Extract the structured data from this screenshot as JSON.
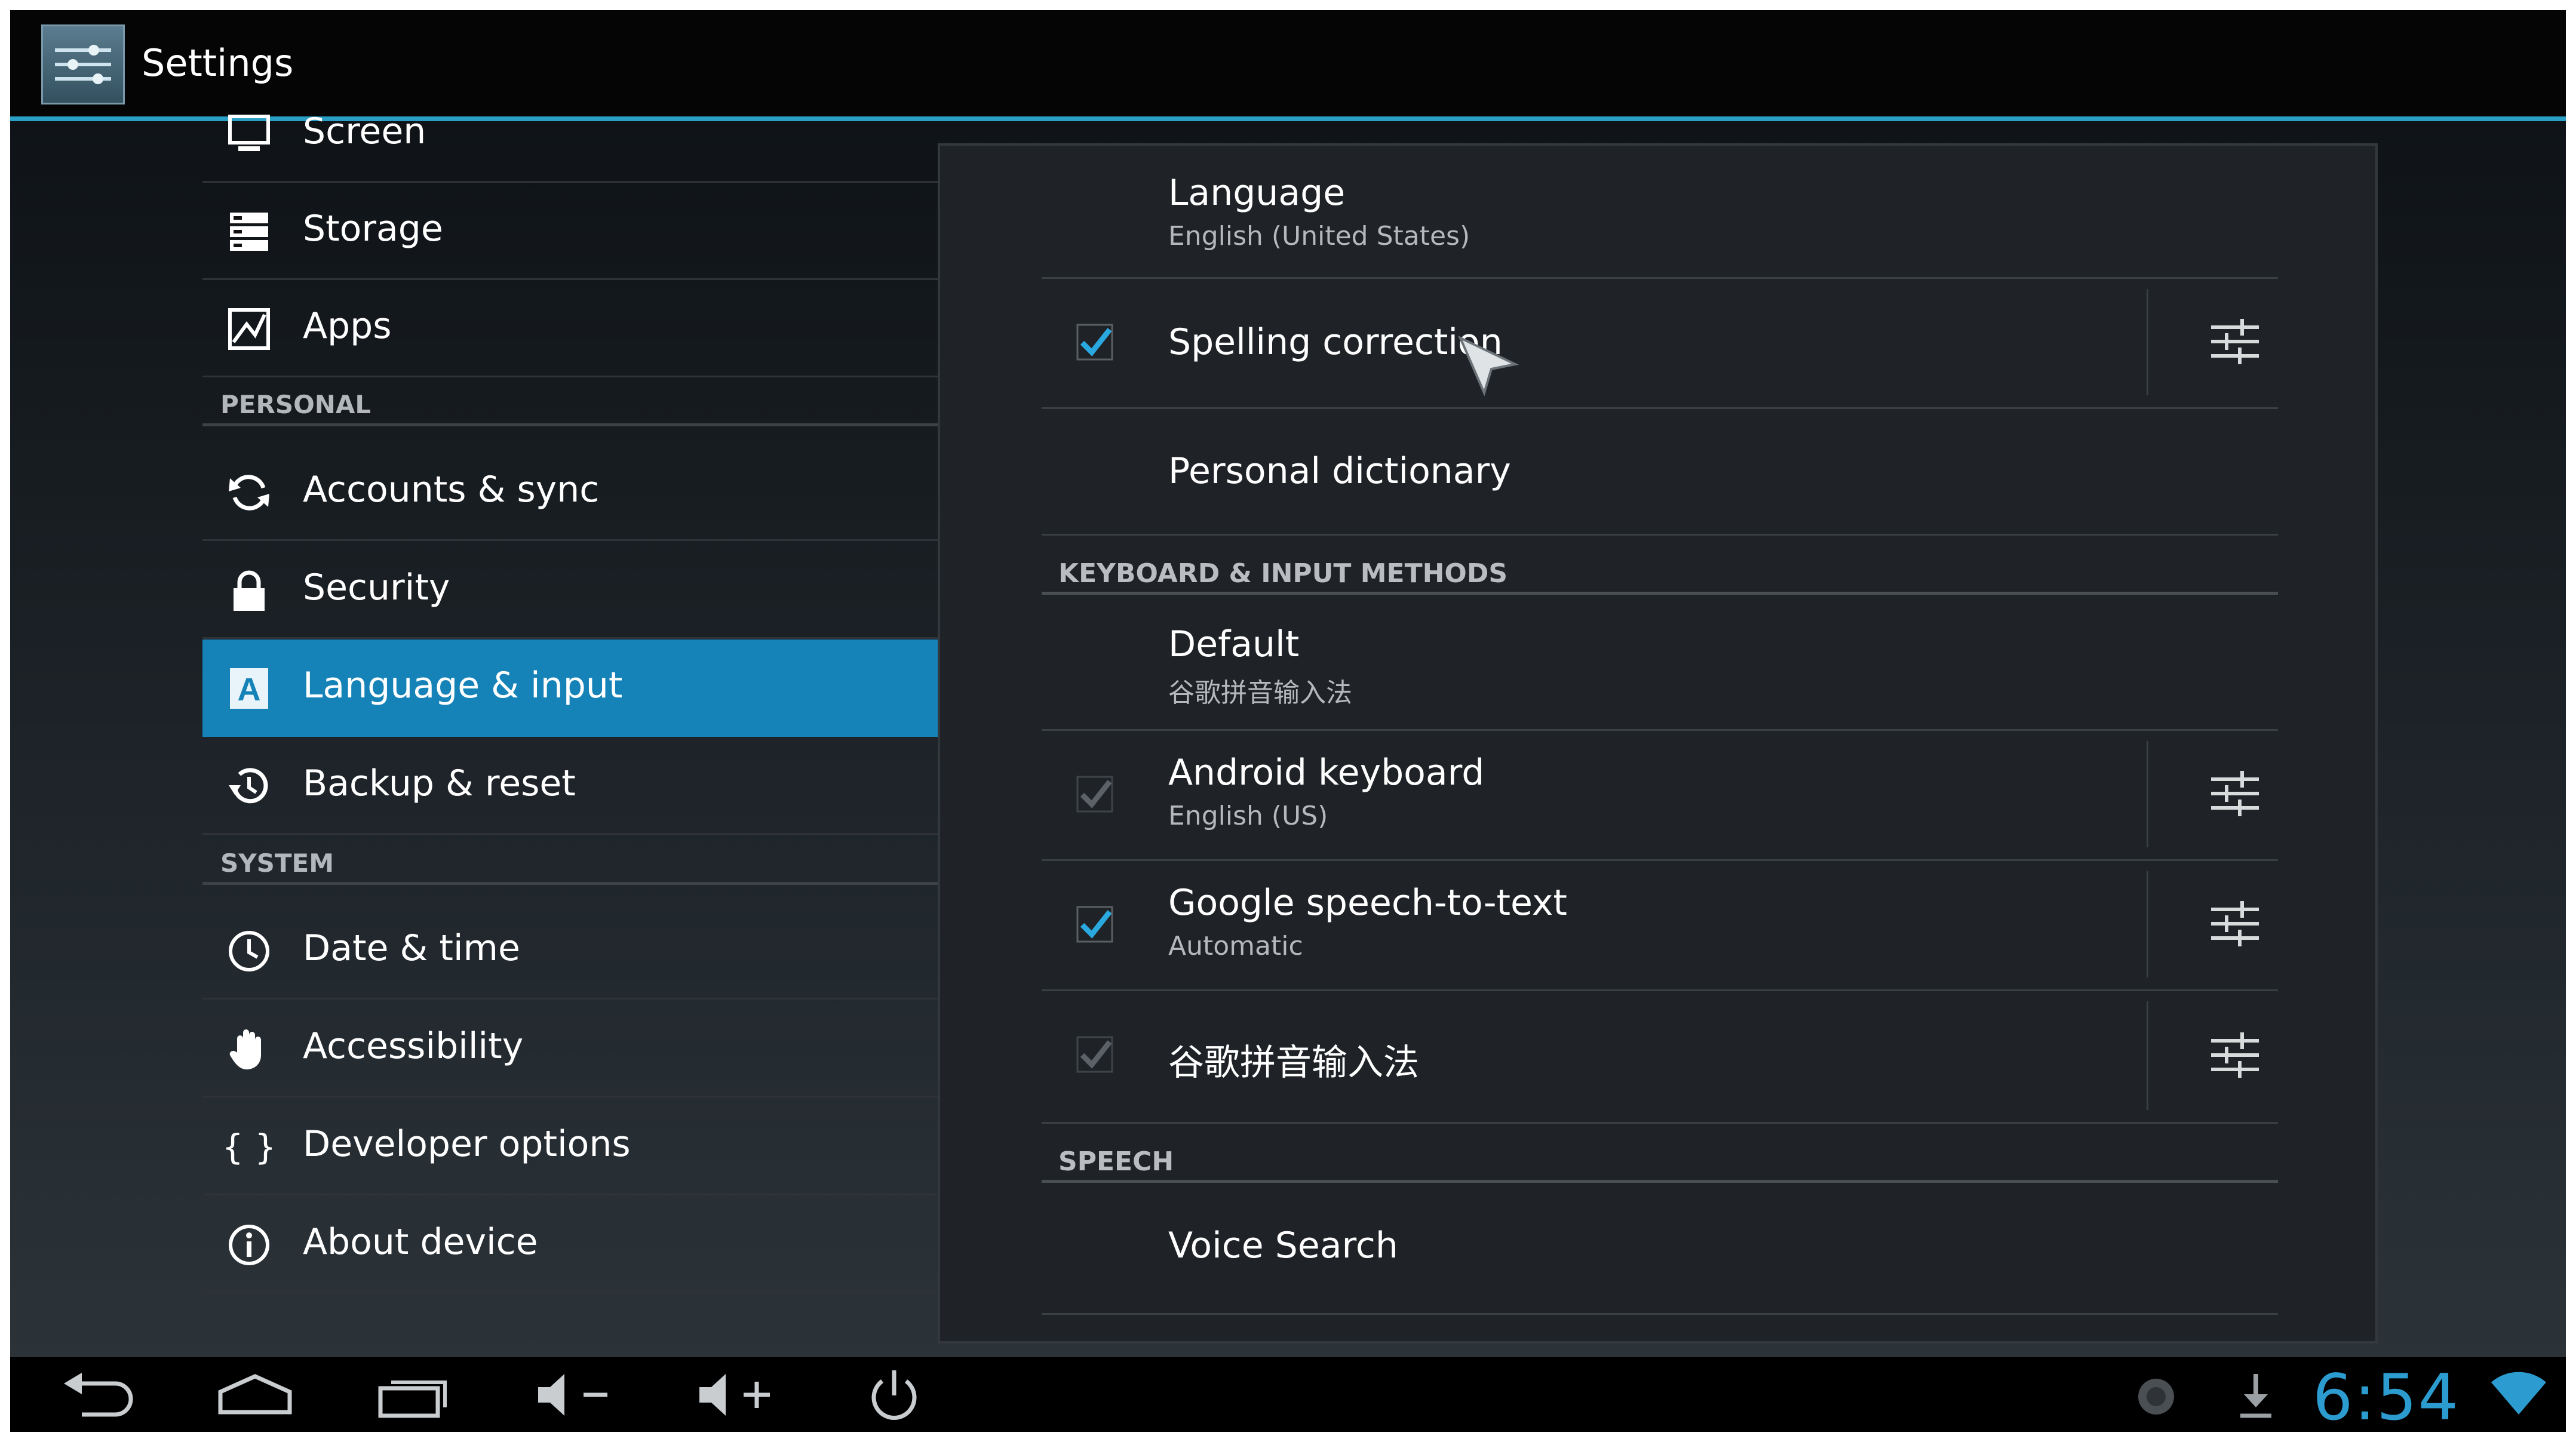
{
  "action_bar": {
    "title": "Settings",
    "icon": "settings-icon"
  },
  "sidebar": {
    "items_top": [
      {
        "label": "Screen",
        "icon": "screen-icon"
      },
      {
        "label": "Storage",
        "icon": "storage-icon"
      },
      {
        "label": "Apps",
        "icon": "apps-icon"
      }
    ],
    "section_personal": "PERSONAL",
    "items_personal": [
      {
        "label": "Accounts & sync",
        "icon": "sync-icon"
      },
      {
        "label": "Security",
        "icon": "lock-icon"
      },
      {
        "label": "Language & input",
        "icon": "language-icon",
        "selected": true
      },
      {
        "label": "Backup & reset",
        "icon": "backup-icon"
      }
    ],
    "section_system": "SYSTEM",
    "items_system": [
      {
        "label": "Date & time",
        "icon": "clock-icon"
      },
      {
        "label": "Accessibility",
        "icon": "hand-icon"
      },
      {
        "label": "Developer options",
        "icon": "braces-icon"
      },
      {
        "label": "About device",
        "icon": "info-icon"
      }
    ]
  },
  "panel": {
    "language": {
      "title": "Language",
      "summary": "English (United States)"
    },
    "spelling": {
      "title": "Spelling correction",
      "checked": true
    },
    "dictionary": {
      "title": "Personal dictionary"
    },
    "keyboard_section": "KEYBOARD & INPUT METHODS",
    "default": {
      "title": "Default",
      "summary": "谷歌拼音输入法"
    },
    "android_keyboard": {
      "title": "Android keyboard",
      "summary": "English (US)",
      "checked": true,
      "enabled": false
    },
    "speech_to_text": {
      "title": "Google speech-to-text",
      "summary": "Automatic",
      "checked": true,
      "enabled": true
    },
    "pinyin": {
      "title": "谷歌拼音输入法",
      "checked": true,
      "enabled": false
    },
    "speech_section": "SPEECH",
    "voice_search": {
      "title": "Voice Search"
    }
  },
  "nav_bar": {
    "buttons": [
      "back-icon",
      "home-icon",
      "recent-apps-icon",
      "volume-down-icon",
      "volume-up-icon",
      "power-icon"
    ],
    "clock": "6:54",
    "status_icons": [
      "notification-dot-icon",
      "download-icon",
      "wifi-icon"
    ]
  },
  "colors": {
    "accent": "#1683b8",
    "clock": "#2c9cd0",
    "check": "#2aa8e0"
  }
}
